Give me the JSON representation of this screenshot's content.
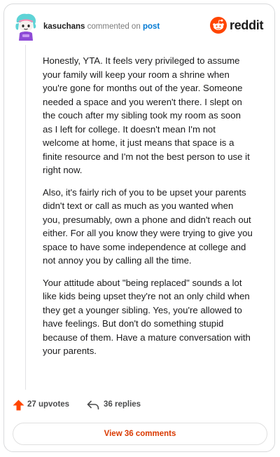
{
  "header": {
    "username": "kasuchans",
    "action_text": "commented on",
    "post_link": "post",
    "brand_name": "reddit",
    "brand_color": "#FF4500"
  },
  "comment": {
    "paragraphs": [
      "Honestly, YTA. It feels very privileged to assume your family will keep your room a shrine when you're gone for months out of the year. Someone needed a space and you weren't there. I slept on the couch after my sibling took my room as soon as I left for college. It doesn't mean I'm not welcome at home, it just means that space is a finite resource and I'm not the best person to use it right now.",
      "Also, it's fairly rich of you to be upset your parents didn't text or call as much as you wanted when you, presumably, own a phone and didn't reach out either. For all you know they were trying to give you space to have some independence at college and not annoy you by calling all the time.",
      "Your attitude about \"being replaced\" sounds a lot like kids being upset they're not an only child when they get a younger sibling. Yes, you're allowed to have feelings. But don't do something stupid because of them. Have a mature conversation with your parents."
    ]
  },
  "actions": {
    "upvotes_label": "27 upvotes",
    "replies_label": "36 replies",
    "view_comments_label": "View 36 comments"
  },
  "icons": {
    "upvote": "upvote-arrow-icon",
    "reply": "reply-arrow-icon",
    "avatar": "snoo-avatar",
    "brand": "reddit-logo-icon"
  },
  "colors": {
    "upvote": "#FF4500",
    "link": "#0079D3",
    "view_button_text": "#D93900"
  }
}
